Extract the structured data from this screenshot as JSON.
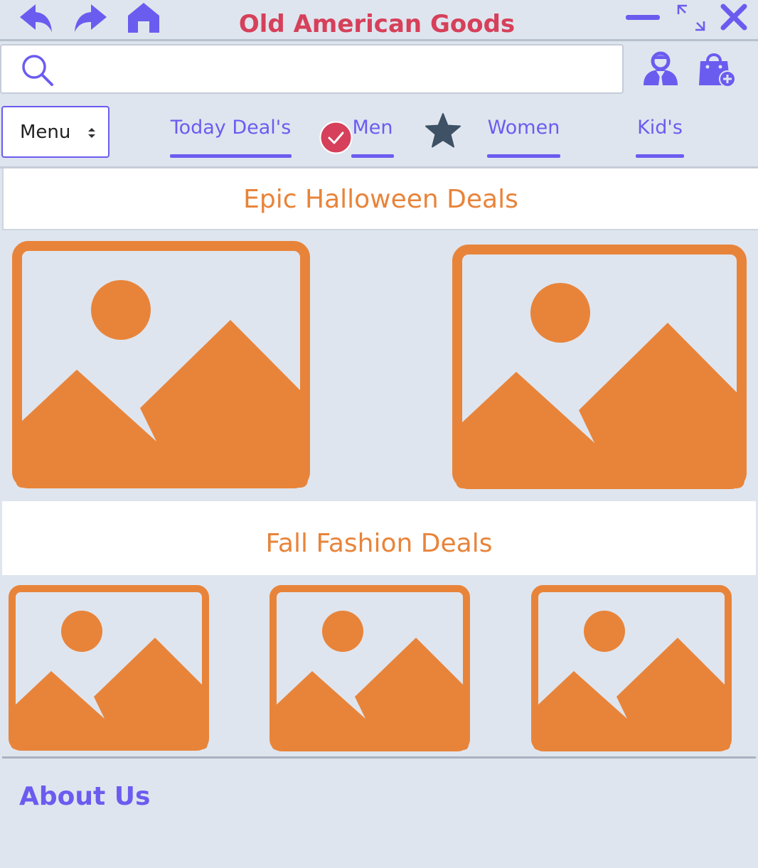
{
  "window": {
    "title": "Old American Goods",
    "title_color": "#d6405a",
    "accent_color": "#6b5cf0"
  },
  "toolbar": {
    "back_icon": "back-arrow-icon",
    "forward_icon": "forward-arrow-icon",
    "home_icon": "home-icon",
    "minimize_icon": "minimize-icon",
    "maximize_icon": "maximize-icon",
    "close_icon": "close-icon"
  },
  "search": {
    "value": "",
    "placeholder": ""
  },
  "header_icons": [
    "user-account-icon",
    "shopping-bag-add-icon"
  ],
  "menu": {
    "label": "Menu"
  },
  "tabs": [
    {
      "label": "Today Deal's"
    },
    {
      "label": "Men"
    },
    {
      "label": "Women"
    },
    {
      "label": "Kid's"
    }
  ],
  "badges": {
    "check_color": "#d6405a",
    "star_color": "#3e5165"
  },
  "sections": [
    {
      "title": "Epic Halloween Deals",
      "image_count": 2
    },
    {
      "title": "Fall Fashion Deals",
      "image_count": 3
    }
  ],
  "section_color": "#e8843a",
  "footer": {
    "about_label": "About Us"
  }
}
